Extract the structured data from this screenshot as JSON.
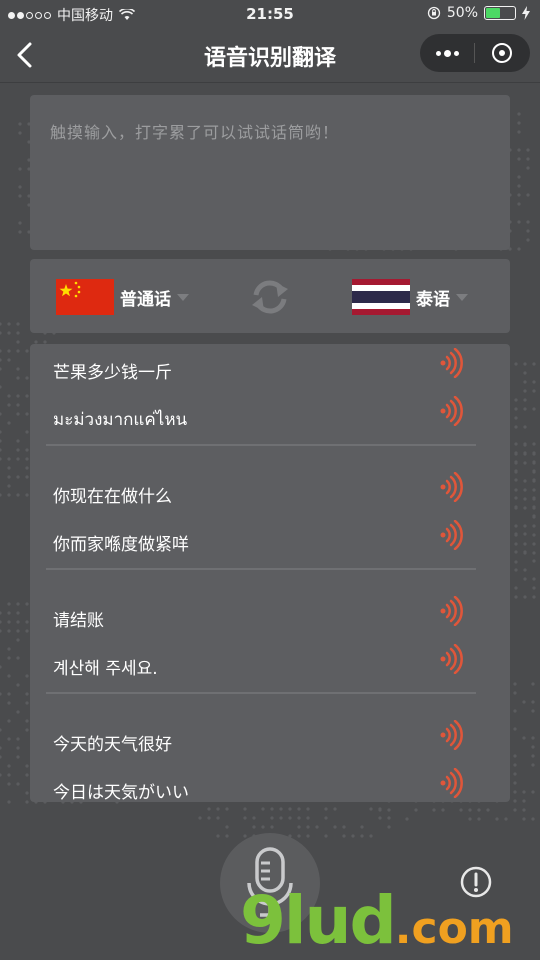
{
  "status_bar": {
    "carrier": "中国移动",
    "time": "21:55",
    "battery_percent": "50%",
    "battery_level": 0.5,
    "signal_bars": 2
  },
  "nav": {
    "title": "语音识别翻译"
  },
  "input": {
    "placeholder": "触摸输入，打字累了可以试试话筒哟！"
  },
  "languages": {
    "source": {
      "label": "普通话",
      "flag": "china-flag"
    },
    "target": {
      "label": "泰语",
      "flag": "thailand-flag"
    }
  },
  "translations": [
    {
      "source": "芒果多少钱一斤",
      "target": "มะม่วงมากแค่ไหน"
    },
    {
      "source": "你现在在做什么",
      "target": "你而家喺度做紧咩"
    },
    {
      "source": "请结账",
      "target": "계산해 주세요."
    },
    {
      "source": "今天的天气很好",
      "target": "今日は天気がいい"
    }
  ],
  "watermark": {
    "main": "9lud",
    "suffix": ".com"
  },
  "colors": {
    "background": "#4a4b4d",
    "card": "#5d5e61",
    "speaker": "#e0563a",
    "watermark_green": "#7cc13c",
    "watermark_orange": "#f0a020"
  }
}
